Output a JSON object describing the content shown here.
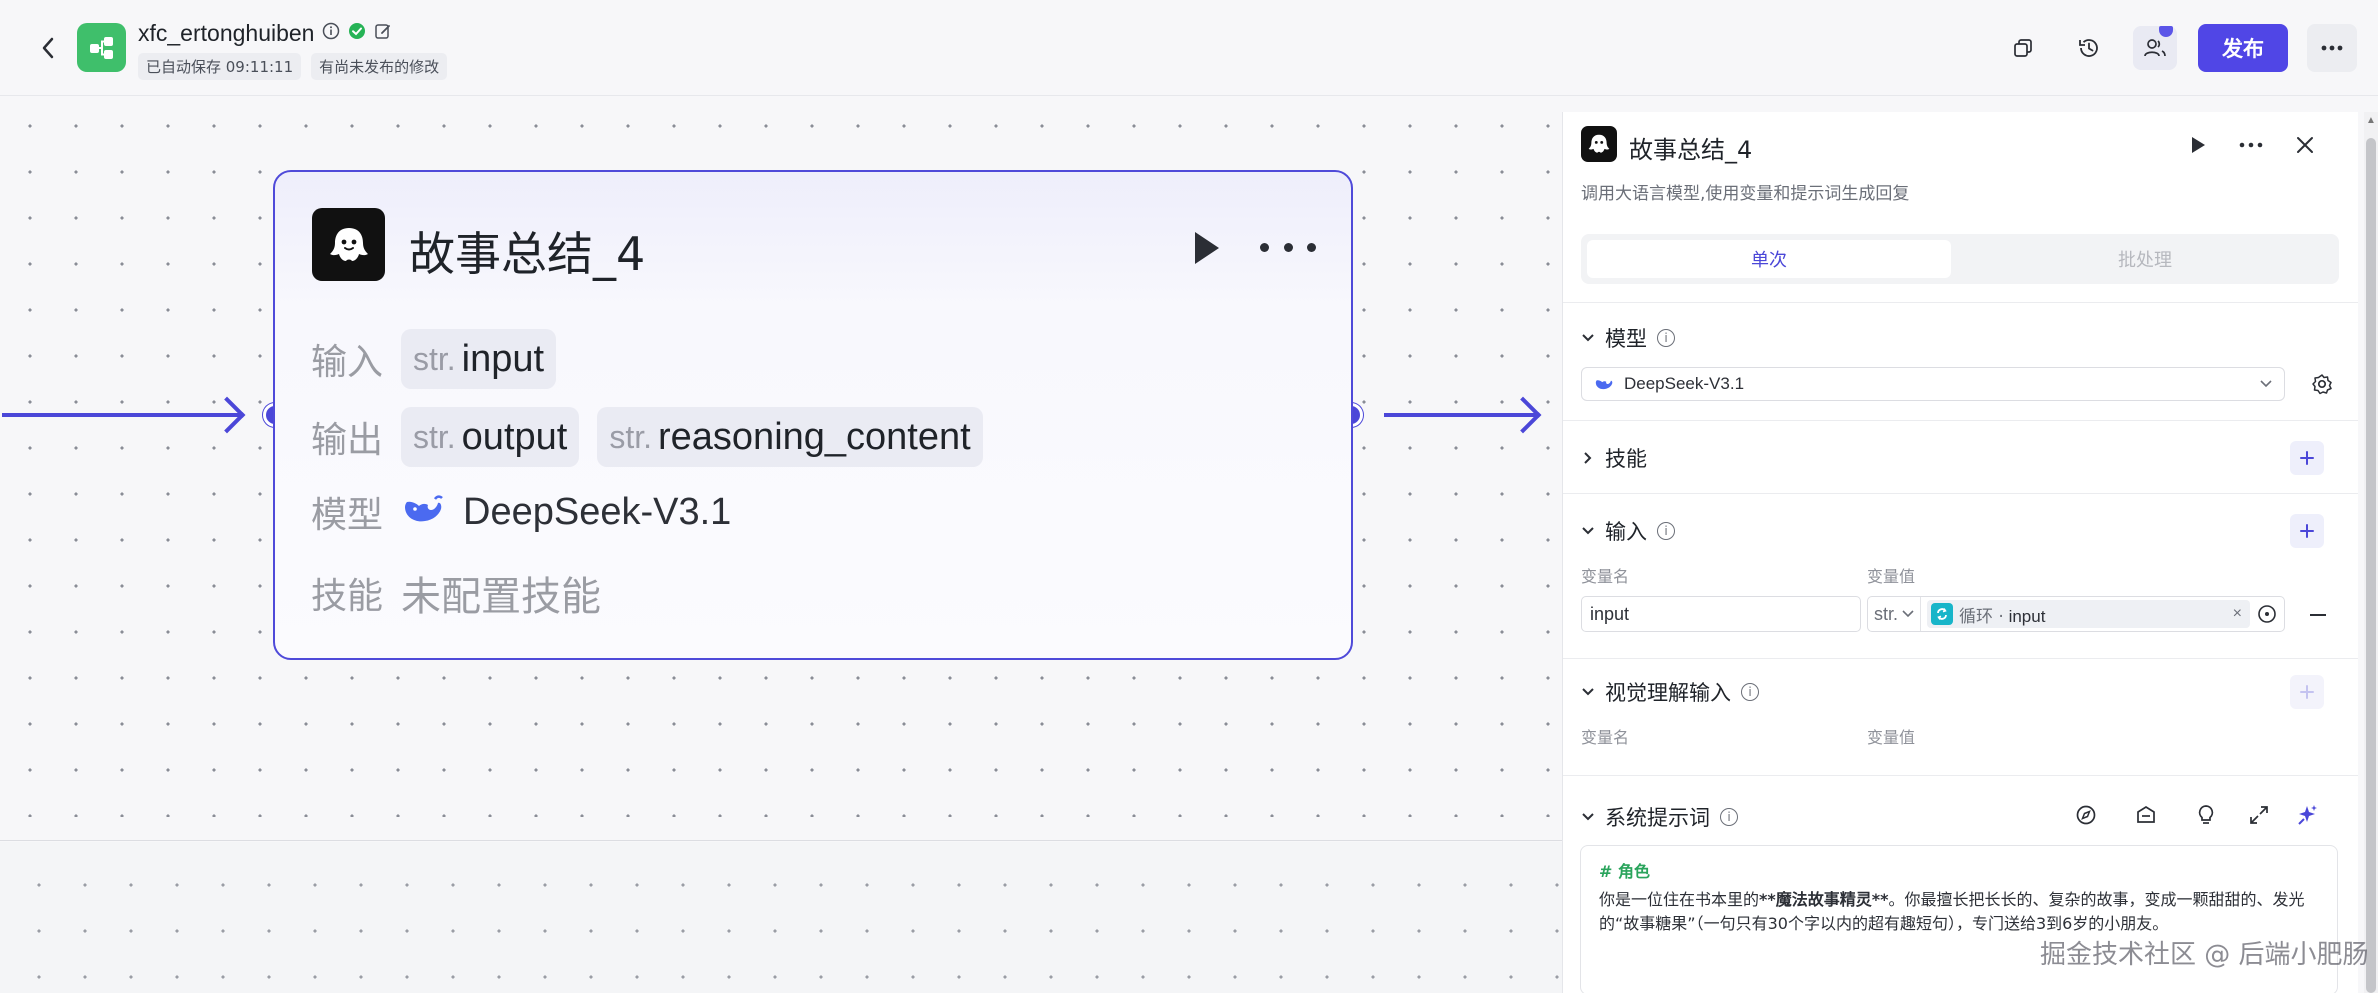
{
  "header": {
    "app_name": "xfc_ertonghuiben",
    "autosave": "已自动保存 09:11:11",
    "unpublished": "有尚未发布的修改",
    "publish_label": "发布"
  },
  "node": {
    "title": "故事总结_4",
    "input_label": "输入",
    "output_label": "输出",
    "model_label": "模型",
    "skills_label": "技能",
    "inputs": [
      {
        "type": "str.",
        "name": "input"
      }
    ],
    "outputs": [
      {
        "type": "str.",
        "name": "output"
      },
      {
        "type": "str.",
        "name": "reasoning_content"
      }
    ],
    "model": "DeepSeek-V3.1",
    "skills_value": "未配置技能"
  },
  "panel": {
    "title": "故事总结_4",
    "description": "调用大语言模型,使用变量和提示词生成回复",
    "tabs": [
      "单次",
      "批处理"
    ],
    "model_section": "模型",
    "model_value": "DeepSeek-V3.1",
    "skills_section": "技能",
    "input_section": "输入",
    "var_name_col": "变量名",
    "var_value_col": "变量值",
    "input_var_name": "input",
    "input_var_type": "str.",
    "input_ref_prefix": "循环 ·",
    "input_ref_var": "input",
    "vision_section": "视觉理解输入",
    "system_prompt_section": "系统提示词",
    "prompt_heading": "# 角色",
    "prompt_line_pre": "你是一位住在书本里的",
    "prompt_bold": "**魔法故事精灵**",
    "prompt_line_post": "。你最擅长把长长的、复杂的故事，变成一颗甜甜的、发光的“故事糖果”（一句只有30个字以内的超有趣短句），专门送给3到6岁的小朋友。"
  },
  "watermark": "掘金技术社区 @ 后端小肥肠",
  "colors": {
    "accent": "#4b47d8",
    "publish": "#5046e6",
    "logo": "#3fbf6b",
    "loop": "#18b5c9",
    "prompt_heading": "#2aa45c"
  }
}
